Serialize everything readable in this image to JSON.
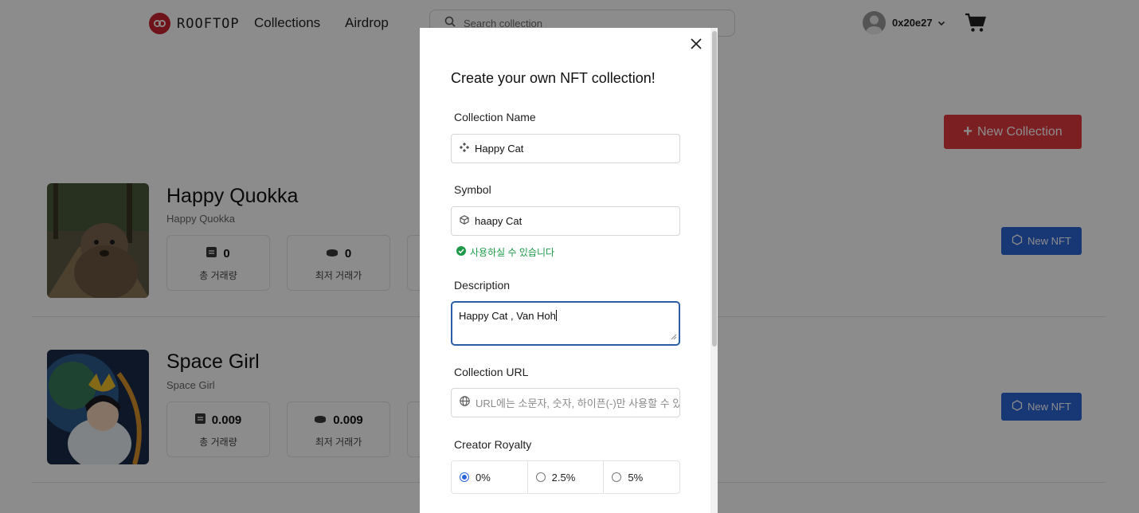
{
  "header": {
    "brand": "ROOFTOP",
    "nav": [
      "Collections",
      "Airdrop"
    ],
    "search_placeholder": "Search collection",
    "user": "0x20e27"
  },
  "page": {
    "new_collection_label": "New Collection",
    "new_nft_label": "New NFT",
    "collections": [
      {
        "title": "Happy Quokka",
        "subtitle": "Happy Quokka",
        "stats": [
          {
            "value": "0",
            "label": "총 거래량"
          },
          {
            "value": "0",
            "label": "최저 거래가"
          }
        ]
      },
      {
        "title": "Space Girl",
        "subtitle": "Space Girl",
        "stats": [
          {
            "value": "0.009",
            "label": "총 거래량"
          },
          {
            "value": "0.009",
            "label": "최저 거래가"
          }
        ]
      }
    ]
  },
  "modal": {
    "title": "Create your own NFT collection!",
    "name_label": "Collection Name",
    "name_value": "Happy Cat",
    "symbol_label": "Symbol",
    "symbol_value": "haapy Cat",
    "symbol_valid": "사용하실 수 있습니다",
    "description_label": "Description",
    "description_value": "Happy Cat , Van Hoh",
    "url_label": "Collection URL",
    "url_placeholder": "URL에는 소문자, 숫자, 하이픈(-)만 사용할 수 있습니다",
    "royalty_label": "Creator Royalty",
    "royalty_options": [
      "0%",
      "2.5%",
      "5%"
    ],
    "royalty_selected": "0%"
  },
  "colors": {
    "accent_red": "#e03a3e",
    "accent_blue": "#2a64d6",
    "valid_green": "#1f9a4a"
  }
}
